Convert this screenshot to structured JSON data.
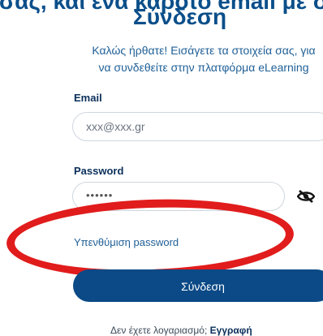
{
  "header": {
    "top_text": "σας, και ένα καρότο email με σ",
    "title": "Σύνδεση",
    "subtitle": "Καλώς ήρθατε! Εισάγετε τα στοιχεία σας, για να συνδεθείτε στην πλατφόρμα eLearning"
  },
  "form": {
    "email_label": "Email",
    "email_value": "xxx@xxx.gr",
    "password_label": "Password",
    "password_value": "••••••",
    "toggle_icon": "eye-slash-icon",
    "remind_label": "Υπενθύμιση password",
    "submit_label": "Σύνδεση"
  },
  "footer": {
    "question": "Δεν έχετε λογαριασμό;",
    "register_label": "Εγγραφή"
  },
  "colors": {
    "primary": "#0b4a86",
    "highlight": "#e11c1c"
  }
}
